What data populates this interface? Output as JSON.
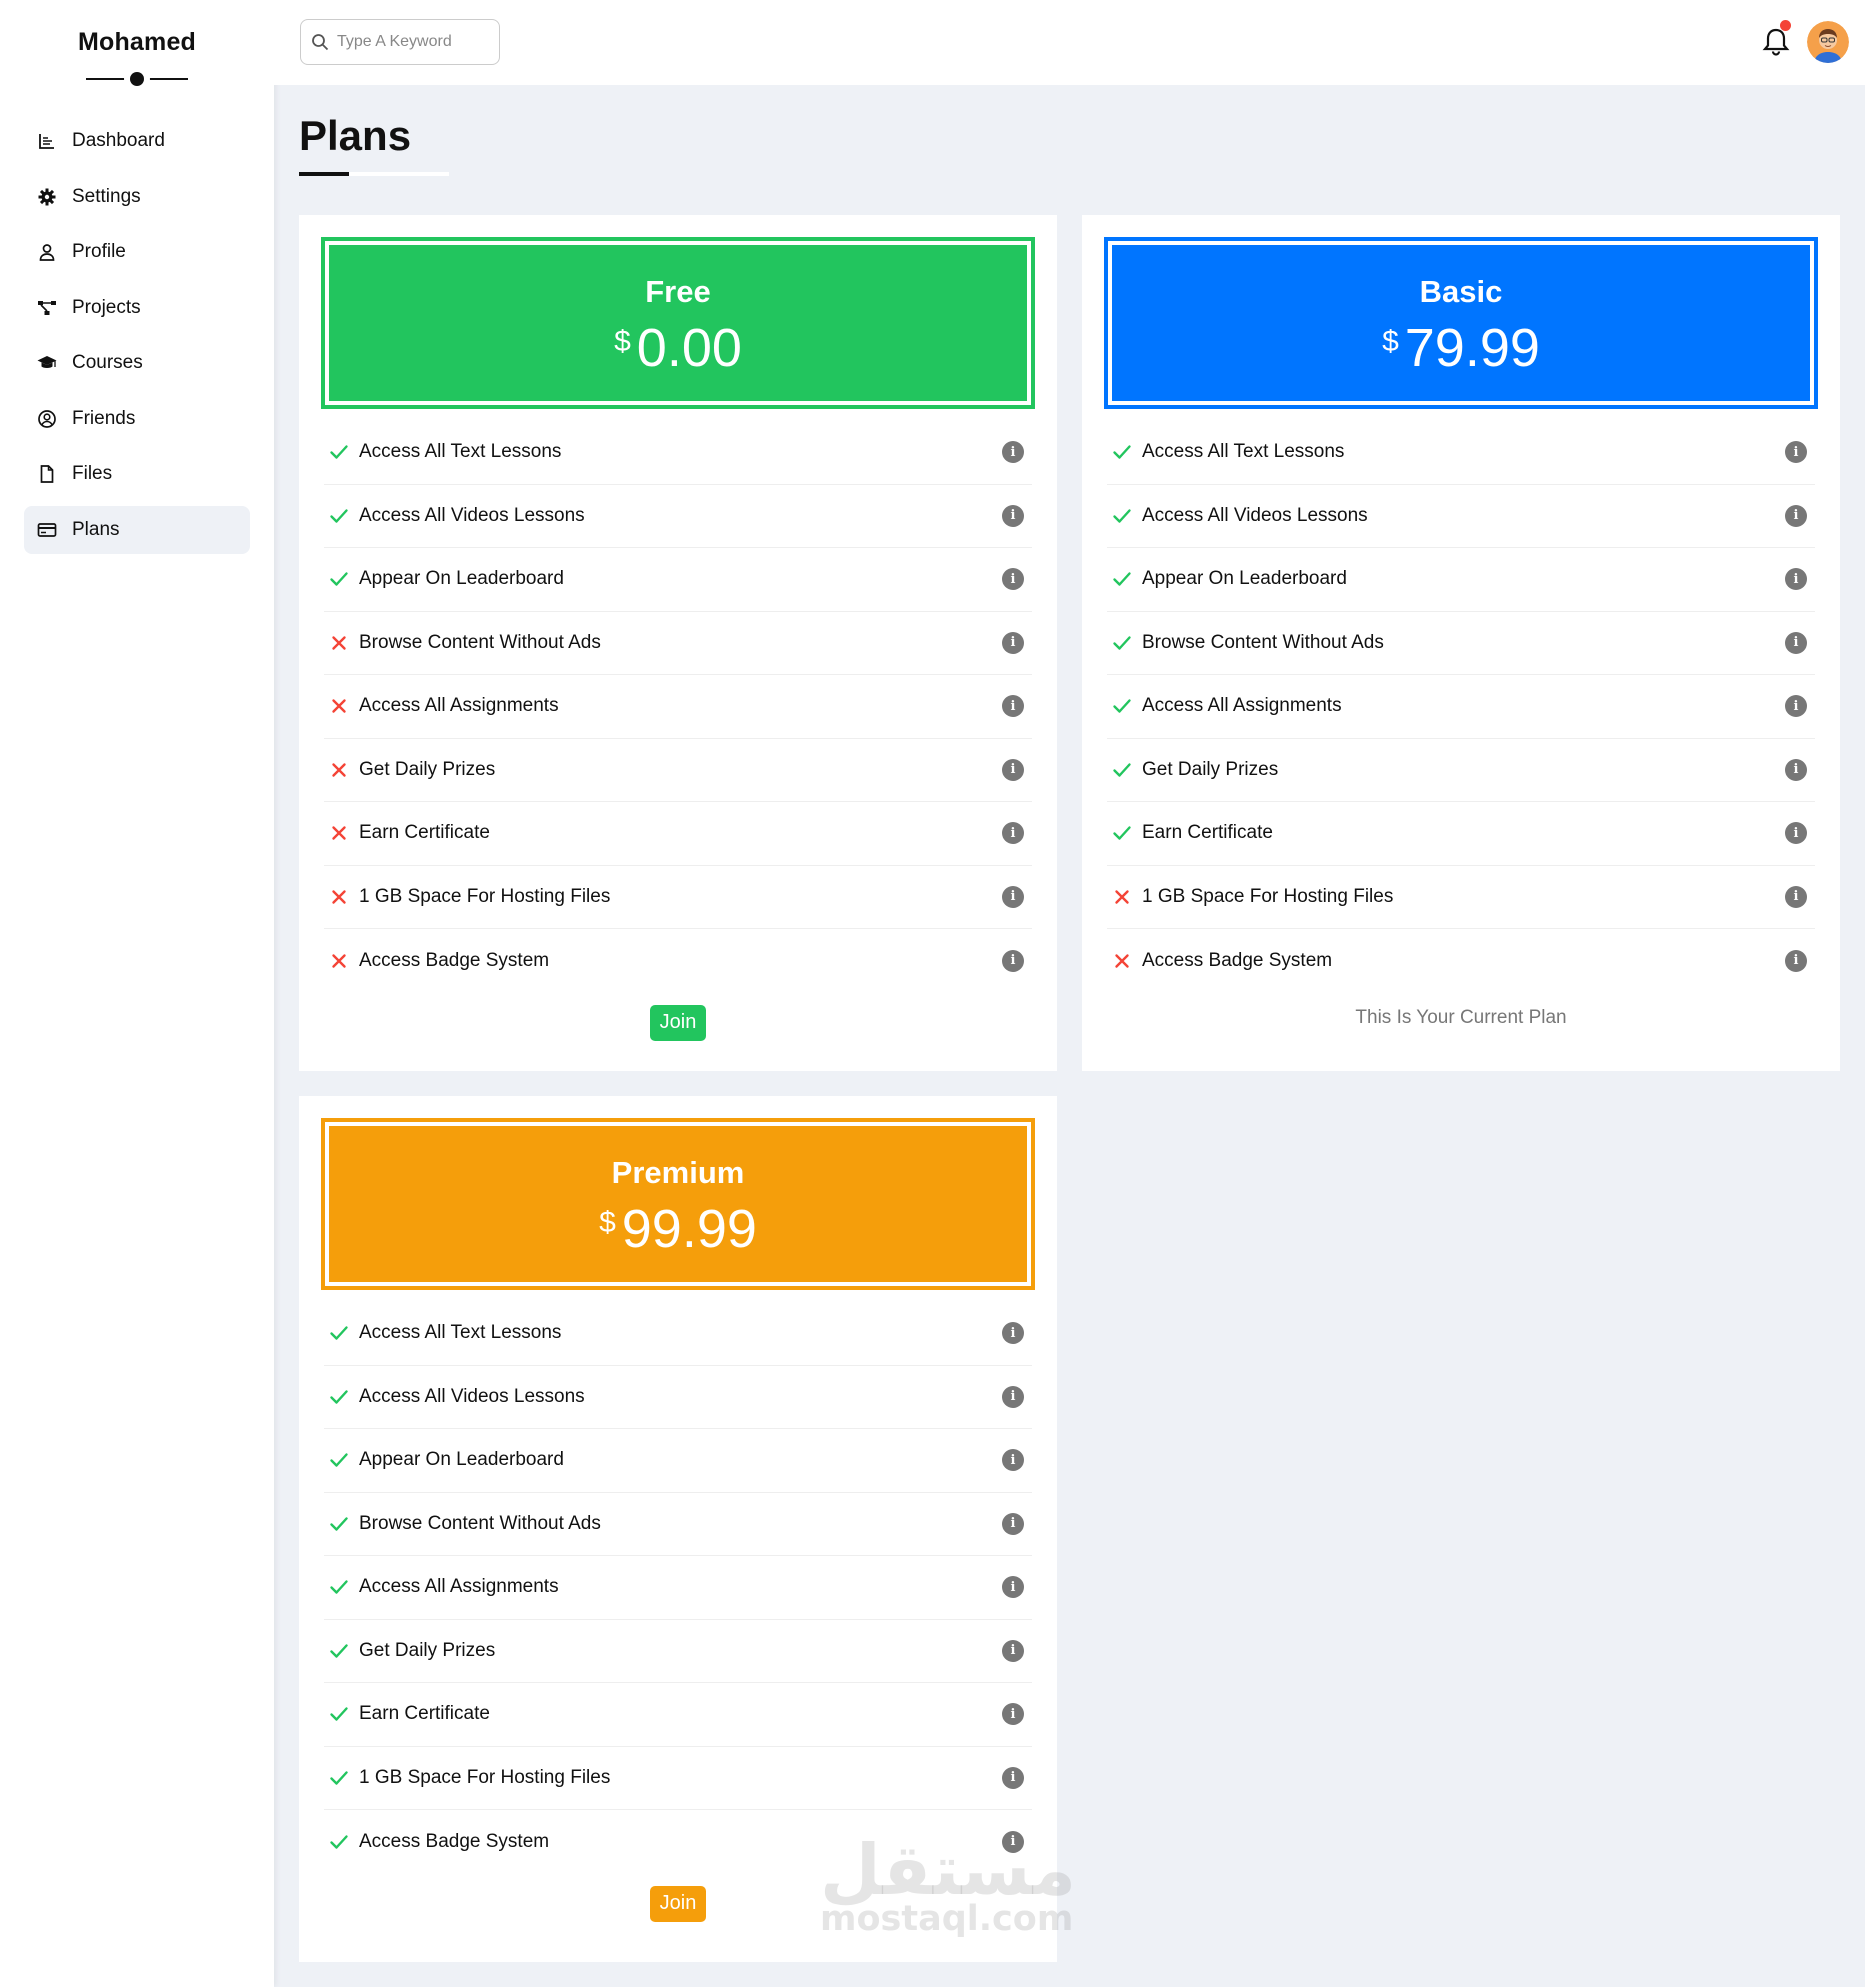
{
  "sidebar": {
    "brand": "Mohamed",
    "items": [
      {
        "label": "Dashboard",
        "icon": "chart-icon",
        "active": false
      },
      {
        "label": "Settings",
        "icon": "gear-icon",
        "active": false
      },
      {
        "label": "Profile",
        "icon": "user-icon",
        "active": false
      },
      {
        "label": "Projects",
        "icon": "diagram-project-icon",
        "active": false
      },
      {
        "label": "Courses",
        "icon": "graduation-cap-icon",
        "active": false
      },
      {
        "label": "Friends",
        "icon": "user-circle-icon",
        "active": false
      },
      {
        "label": "Files",
        "icon": "file-icon",
        "active": false
      },
      {
        "label": "Plans",
        "icon": "credit-card-icon",
        "active": true
      }
    ]
  },
  "header": {
    "search_placeholder": "Type A Keyword",
    "notifications_icon": "bell-icon",
    "has_notification": true
  },
  "page": {
    "title": "Plans"
  },
  "plans": [
    {
      "name": "Free",
      "currency": "$",
      "price": "0.00",
      "color": "#22c55e",
      "features": [
        {
          "label": "Access All Text Lessons",
          "included": true
        },
        {
          "label": "Access All Videos Lessons",
          "included": true
        },
        {
          "label": "Appear On Leaderboard",
          "included": true
        },
        {
          "label": "Browse Content Without Ads",
          "included": false
        },
        {
          "label": "Access All Assignments",
          "included": false
        },
        {
          "label": "Get Daily Prizes",
          "included": false
        },
        {
          "label": "Earn Certificate",
          "included": false
        },
        {
          "label": "1 GB Space For Hosting Files",
          "included": false
        },
        {
          "label": "Access Badge System",
          "included": false
        }
      ],
      "action_label": "Join"
    },
    {
      "name": "Basic",
      "currency": "$",
      "price": "79.99",
      "color": "#0075ff",
      "features": [
        {
          "label": "Access All Text Lessons",
          "included": true
        },
        {
          "label": "Access All Videos Lessons",
          "included": true
        },
        {
          "label": "Appear On Leaderboard",
          "included": true
        },
        {
          "label": "Browse Content Without Ads",
          "included": true
        },
        {
          "label": "Access All Assignments",
          "included": true
        },
        {
          "label": "Get Daily Prizes",
          "included": true
        },
        {
          "label": "Earn Certificate",
          "included": true
        },
        {
          "label": "1 GB Space For Hosting Files",
          "included": false
        },
        {
          "label": "Access Badge System",
          "included": false
        }
      ],
      "current_label": "This Is Your Current Plan"
    },
    {
      "name": "Premium",
      "currency": "$",
      "price": "99.99",
      "color": "#f59e0b",
      "features": [
        {
          "label": "Access All Text Lessons",
          "included": true
        },
        {
          "label": "Access All Videos Lessons",
          "included": true
        },
        {
          "label": "Appear On Leaderboard",
          "included": true
        },
        {
          "label": "Browse Content Without Ads",
          "included": true
        },
        {
          "label": "Access All Assignments",
          "included": true
        },
        {
          "label": "Get Daily Prizes",
          "included": true
        },
        {
          "label": "Earn Certificate",
          "included": true
        },
        {
          "label": "1 GB Space For Hosting Files",
          "included": true
        },
        {
          "label": "Access Badge System",
          "included": true
        }
      ],
      "action_label": "Join"
    }
  ],
  "colors": {
    "check": "#22c55e",
    "cross": "#f44336",
    "info": "#777777"
  },
  "watermark": {
    "arabic": "مستقل",
    "latin": "mostaql.com"
  }
}
